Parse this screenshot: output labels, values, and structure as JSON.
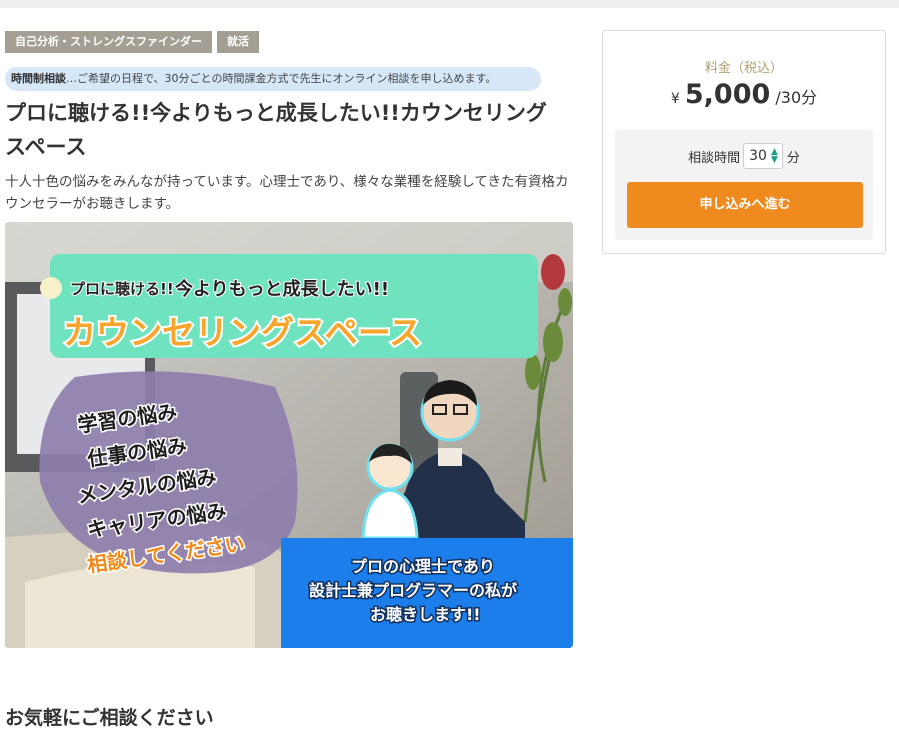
{
  "tags": [
    "自己分析・ストレングスファインダー",
    "就活"
  ],
  "notice": {
    "label": "時間制相談",
    "text": "…ご希望の日程で、30分ごとの時間課金方式で先生にオンライン相談を申し込めます。"
  },
  "title": "プロに聴ける!!今よりもっと成長したい!!カウンセリングスペース",
  "description": "十人十色の悩みをみんなが持っています。心理士であり、様々な業種を経験してきた有資格カウンセラーがお聴きします。",
  "hero": {
    "small_caption": "プロに聴ける!!",
    "tagline": "今よりもっと成長したい!!",
    "banner": "カウンセリングスペース",
    "worries": [
      "学習の悩み",
      "仕事の悩み",
      "メンタルの悩み",
      "キャリアの悩み"
    ],
    "cta": "相談してください",
    "intro_lines": [
      "プロの心理士であり",
      "設計士兼プログラマーの私が",
      "お聴きします!!"
    ]
  },
  "section_heading": "お気軽にご相談ください",
  "pricing": {
    "label": "料金（税込）",
    "currency": "¥",
    "amount": "5,000",
    "unit": "/30分",
    "duration_label": "相談時間",
    "duration_value": "30",
    "duration_unit": "分",
    "apply_label": "申し込みへ進む"
  }
}
